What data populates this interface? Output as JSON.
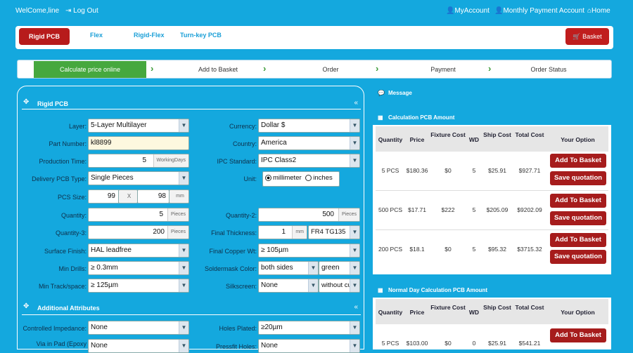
{
  "topbar": {
    "welcome": "WelCome,line",
    "logout": "Log Out",
    "my_account": "MyAccount",
    "monthly": "Monthly Payment Account",
    "home": "Home"
  },
  "nav": {
    "rigid": "Rigid PCB",
    "flex": "Flex",
    "rigid_flex": "Rigid-Flex",
    "turnkey": "Turn-key PCB",
    "basket": "Basket"
  },
  "steps": [
    "Calculate price online",
    "Add to Basket",
    "Order",
    "Payment",
    "Order Status"
  ],
  "colors": {
    "brand": "#14a8de",
    "active_step": "#46a83e",
    "red": "#a61c1c"
  },
  "form": {
    "section_title": "Rigid PCB",
    "section2_title": "Additional Attributes",
    "layer_label": "Layer:",
    "layer": "5-Layer Multilayer",
    "part_label": "Part Number:",
    "part": "kl8899",
    "prod_label": "Production Time:",
    "prod": "5",
    "prod_unit": "WorkingDays",
    "delivery_label": "Delivery PCB Type:",
    "delivery": "Single Pieces",
    "size_label": "PCS Size:",
    "size_w": "99",
    "size_x": "X",
    "size_h": "98",
    "size_unit": "mm",
    "qty_label": "Quantity:",
    "qty": "5",
    "qty_unit": "Pieces",
    "qty3_label": "Quantity-3:",
    "qty3": "200",
    "qty3_unit": "Pieces",
    "surface_label": "Surface Finish:",
    "surface": "HAL leadfree",
    "drill_label": "Min Drills:",
    "drill": "≥ 0.3mm",
    "track_label": "Min Track/space:",
    "track": "≥ 125µm",
    "currency_label": "Currency:",
    "currency": "Dollar $",
    "country_label": "Country:",
    "country": "America",
    "ipc_label": "IPC Standard:",
    "ipc": "IPC Class2",
    "unit_label": "Unit:",
    "unit_mm": "millimeter",
    "unit_in": "inches",
    "qty2_label": "Quantity-2:",
    "qty2": "500",
    "qty2_unit": "Pieces",
    "thick_label": "Final Thickness:",
    "thick": "1",
    "thick_unit": "mm",
    "thick_mat": "FR4 TG135",
    "copper_label": "Final Copper Wt:",
    "copper": "≥ 105µm",
    "mask_label": "Soldermask Color:",
    "mask_side": "both sides",
    "mask_color": "green",
    "silk_label": "Silkscreen:",
    "silk": "None",
    "silk_side": "without cut",
    "ci_label": "Controlled Impedance:",
    "ci": "None",
    "via_label": "Via in Pad (Epoxy",
    "via": "None",
    "holes_label": "Holes Plated:",
    "holes": "≥20µm",
    "press_label": "Pressfit Holes:",
    "press": "None"
  },
  "message": {
    "title": "Message"
  },
  "calc": {
    "title": "Calculation PCB Amount",
    "headers": [
      "Quantity",
      "Price",
      "Fixture Cost",
      "WD",
      "Ship Cost",
      "Total Cost",
      "Your Option"
    ],
    "rows": [
      [
        "5 PCS",
        "$180.36",
        "$0",
        "5",
        "$25.91",
        "$927.71"
      ],
      [
        "500 PCS",
        "$17.71",
        "$222",
        "5",
        "$205.09",
        "$9202.09"
      ],
      [
        "200 PCS",
        "$18.1",
        "$0",
        "5",
        "$95.32",
        "$3715.32"
      ]
    ],
    "add_btn": "Add To Basket",
    "save_btn": "Save quotation"
  },
  "normal": {
    "title": "Normal Day Calculation PCB Amount",
    "headers": [
      "Quantity",
      "Price",
      "Fixture Cost",
      "WD",
      "Ship Cost",
      "Total Cost",
      "Your Option"
    ],
    "rows": [
      [
        "5 PCS",
        "$103.00",
        "$0",
        "0",
        "$25.91",
        "$541.21"
      ]
    ],
    "add_btn": "Add To Basket"
  }
}
